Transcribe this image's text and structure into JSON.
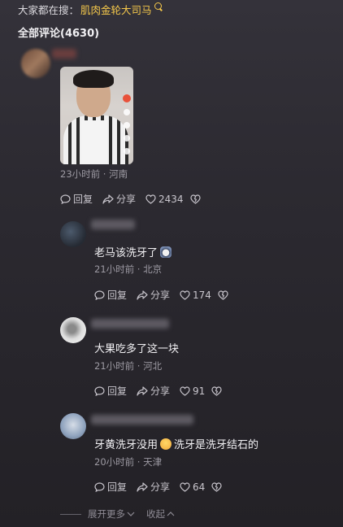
{
  "search": {
    "prefix": "大家都在搜：",
    "keyword": "肌肉金轮大司马"
  },
  "comments_header": "全部评论(4630)",
  "top_comment": {
    "meta": "23小时前 · 河南",
    "reply": "回复",
    "share": "分享",
    "likes": "2434"
  },
  "replies": [
    {
      "text": "老马该洗牙了",
      "meta": "21小时前 · 北京",
      "reply": "回复",
      "share": "分享",
      "likes": "174"
    },
    {
      "text": "大果吃多了这一块",
      "meta": "21小时前 · 河北",
      "reply": "回复",
      "share": "分享",
      "likes": "91"
    },
    {
      "text_a": "牙黄洗牙没用",
      "text_b": "洗牙是洗牙结石的",
      "meta": "20小时前 · 天津",
      "reply": "回复",
      "share": "分享",
      "likes": "64"
    }
  ],
  "footer": {
    "expand": "展开更多",
    "collapse": "收起"
  },
  "colors": {
    "accent": "#f5c84b",
    "background": "#2c2a31",
    "muted": "#9d9aa3"
  }
}
